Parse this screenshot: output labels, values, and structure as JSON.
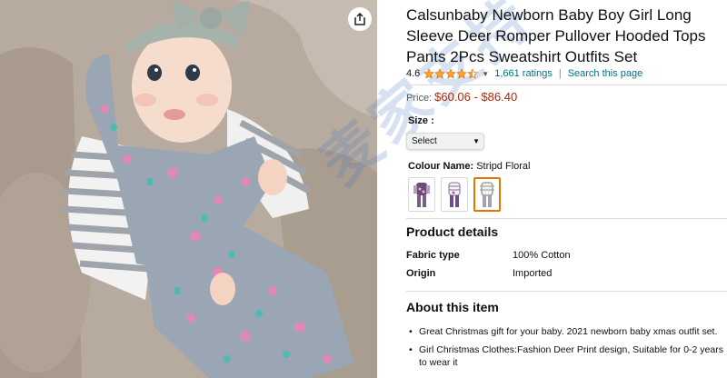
{
  "product": {
    "title": "Calsunbaby Newborn Baby Boy Girl Long Sleeve Deer Romper Pullover Hooded Tops Pants 2Pcs Sweatshirt Outfits Set",
    "rating_value": "4.6",
    "rating_stars": 4.5,
    "ratings_count": "1,661 ratings",
    "search_link": "Search this page",
    "price_label": "Price:",
    "price_range": "$60.06 - $86.40",
    "accent_price_color": "#B12704",
    "link_color": "#007185"
  },
  "size": {
    "label": "Size :",
    "selected": "Select"
  },
  "color": {
    "label": "Colour Name:",
    "selected": "Stripd Floral",
    "swatch_count": 3,
    "selected_index": 2
  },
  "details": {
    "heading": "Product details",
    "rows": [
      {
        "key": "Fabric type",
        "value": "100% Cotton"
      },
      {
        "key": "Origin",
        "value": "Imported"
      }
    ]
  },
  "about": {
    "heading": "About this item",
    "bullets": [
      "Great Christmas gift for your baby. 2021 newborn baby xmas outfit set.",
      "Girl Christmas Clothes:Fashion Deer Print design, Suitable for 0-2 years to wear it"
    ]
  },
  "image": {
    "watermark": "麦家支持"
  },
  "icons": {
    "share": "share-icon",
    "star": "star-icon",
    "chevron": "chevron-down-icon"
  }
}
